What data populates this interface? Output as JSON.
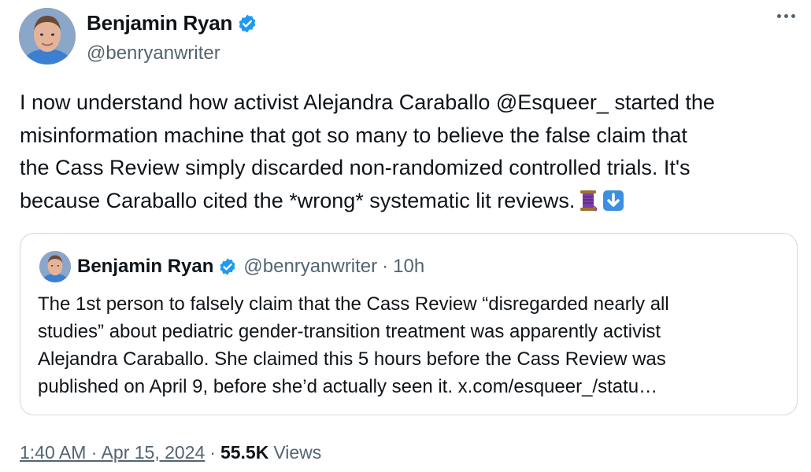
{
  "author": {
    "name": "Benjamin Ryan",
    "handle": "@benryanwriter"
  },
  "tweet": {
    "lines": [
      "I now understand how activist Alejandra Caraballo @Esqueer_ started the",
      "misinformation machine that got so many to believe the false claim that",
      "the Cass Review simply discarded non-randomized controlled trials. It's",
      "because Caraballo cited the *wrong* systematic lit reviews."
    ],
    "emoji": [
      "thread-spool-emoji",
      "down-arrow-emoji"
    ]
  },
  "quote": {
    "name": "Benjamin Ryan",
    "handle": "@benryanwriter",
    "dot": "·",
    "time": "10h",
    "lines": [
      "The 1st person to falsely claim that the Cass Review “disregarded nearly all",
      "studies” about pediatric gender-transition treatment was apparently activist",
      "Alejandra Caraballo. She claimed this 5 hours before the Cass Review was",
      "published on April 9, before she’d actually seen it. x.com/esqueer_/statu…"
    ]
  },
  "meta": {
    "timestamp": "1:40 AM · Apr 15, 2024",
    "sep": "·",
    "views_count": "55.5K",
    "views_label": "Views"
  },
  "colors": {
    "text": "#0f1419",
    "secondary": "#536471",
    "verified": "#1d9bf0",
    "border": "#cfd9de"
  }
}
